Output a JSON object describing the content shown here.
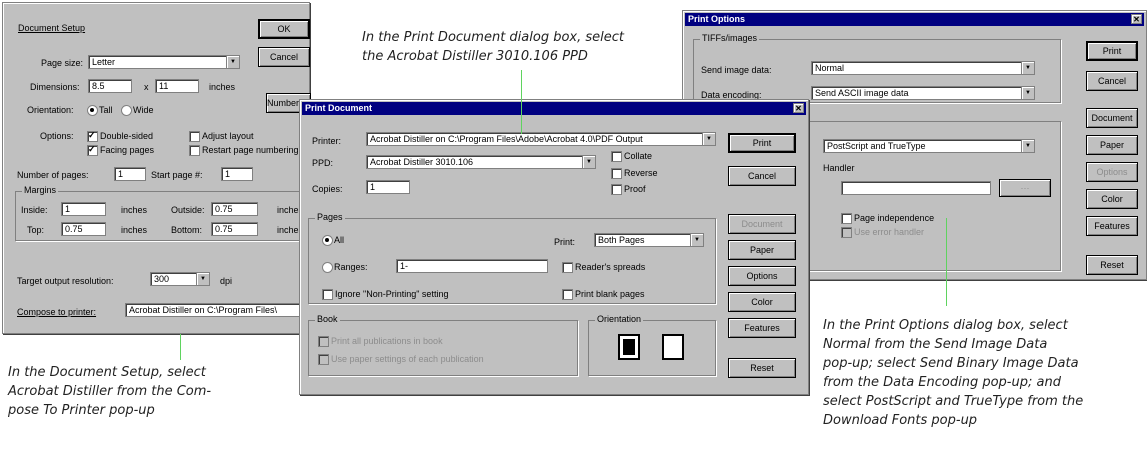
{
  "captions": {
    "document_setup": "In the Document Setup, select Acrobat Distiller from the Com-pose To Printer pop-up",
    "print_document": "In the Print Document dialog box, select the Acrobat Distiller 3010.106 PPD",
    "print_options": "In the Print Options dialog box, select Normal from the Send Image Data pop-up; select Send Binary Image Data from the Data Encoding pop-up; and select PostScript and TrueType from the Download Fonts pop-up",
    "document_setup_lines": [
      "In the Document Setup, select",
      "Acrobat Distiller from the Com-",
      "pose To Printer pop-up"
    ],
    "print_document_lines": [
      "In the Print Document dialog box, select",
      "the Acrobat Distiller 3010.106 PPD"
    ],
    "print_options_lines": [
      "In the Print Options dialog box, select",
      "Normal from the Send Image Data",
      "pop-up; select Send Binary Image Data",
      "from the Data Encoding pop-up; and",
      "select PostScript and TrueType from the",
      "Download Fonts pop-up"
    ]
  },
  "document_setup": {
    "title": "Document Setup",
    "page_size_label": "Page size:",
    "page_size_value": "Letter",
    "dimensions_label": "Dimensions:",
    "width_value": "8.5",
    "times": "x",
    "height_value": "11",
    "inches": "inches",
    "orientation_label": "Orientation:",
    "tall": "Tall",
    "wide": "Wide",
    "options_label": "Options:",
    "double_sided": "Double-sided",
    "facing_pages": "Facing pages",
    "adjust_layout": "Adjust layout",
    "restart_numbering": "Restart page numbering",
    "number_of_pages_label": "Number of pages:",
    "number_of_pages_value": "1",
    "start_page_label": "Start page #:",
    "start_page_value": "1",
    "margins_label": "Margins",
    "inside_label": "Inside:",
    "inside_value": "1",
    "outside_label": "Outside:",
    "outside_value": "0.75",
    "top_label": "Top:",
    "top_value": "0.75",
    "bottom_label": "Bottom:",
    "bottom_value": "0.75",
    "target_resolution_label": "Target output resolution:",
    "target_resolution_value": "300",
    "dpi": "dpi",
    "compose_label": "Compose to printer:",
    "compose_value": "Acrobat Distiller on C:\\Program Files\\",
    "ok": "OK",
    "cancel": "Cancel",
    "numbers": "Numbers..."
  },
  "print_document": {
    "title": "Print Document",
    "printer_label": "Printer:",
    "printer_value": "Acrobat Distiller on C:\\Program Files\\Adobe\\Acrobat 4.0\\PDF Output",
    "ppd_label": "PPD:",
    "ppd_value": "Acrobat Distiller 3010.106",
    "copies_label": "Copies:",
    "copies_value": "1",
    "collate": "Collate",
    "reverse": "Reverse",
    "proof": "Proof",
    "pages_label": "Pages",
    "all": "All",
    "ranges": "Ranges:",
    "ranges_value": "1-",
    "ignore_nonprinting": "Ignore \"Non-Printing\" setting",
    "print_label": "Print:",
    "print_value": "Both Pages",
    "readers_spreads": "Reader's spreads",
    "print_blank_pages": "Print blank pages",
    "book_label": "Book",
    "print_all_pubs": "Print all publications in book",
    "use_paper_settings": "Use paper settings of each publication",
    "orientation_label": "Orientation",
    "print_btn": "Print",
    "cancel_btn": "Cancel",
    "document_btn": "Document",
    "paper_btn": "Paper",
    "options_btn": "Options",
    "color_btn": "Color",
    "features_btn": "Features",
    "reset_btn": "Reset"
  },
  "print_options": {
    "title": "Print Options",
    "tiff_group": "TIFFs/images",
    "send_image_label": "Send image data:",
    "send_image_value": "Normal",
    "encoding_label": "Data encoding:",
    "encoding_value": "Send ASCII image data",
    "fonts_value": "PostScript and TrueType",
    "handler_label": "Handler",
    "page_independence": "Page independence",
    "error_handler": "Use error handler",
    "print_btn": "Print",
    "cancel_btn": "Cancel",
    "document_btn": "Document",
    "paper_btn": "Paper",
    "options_btn": "Options",
    "color_btn": "Color",
    "features_btn": "Features",
    "reset_btn": "Reset",
    "close_icon": "close-icon"
  },
  "colors": {
    "leader_line": "#5fd35f",
    "dialog_bg": "#c0c0c0",
    "title_bar": "#000080"
  }
}
